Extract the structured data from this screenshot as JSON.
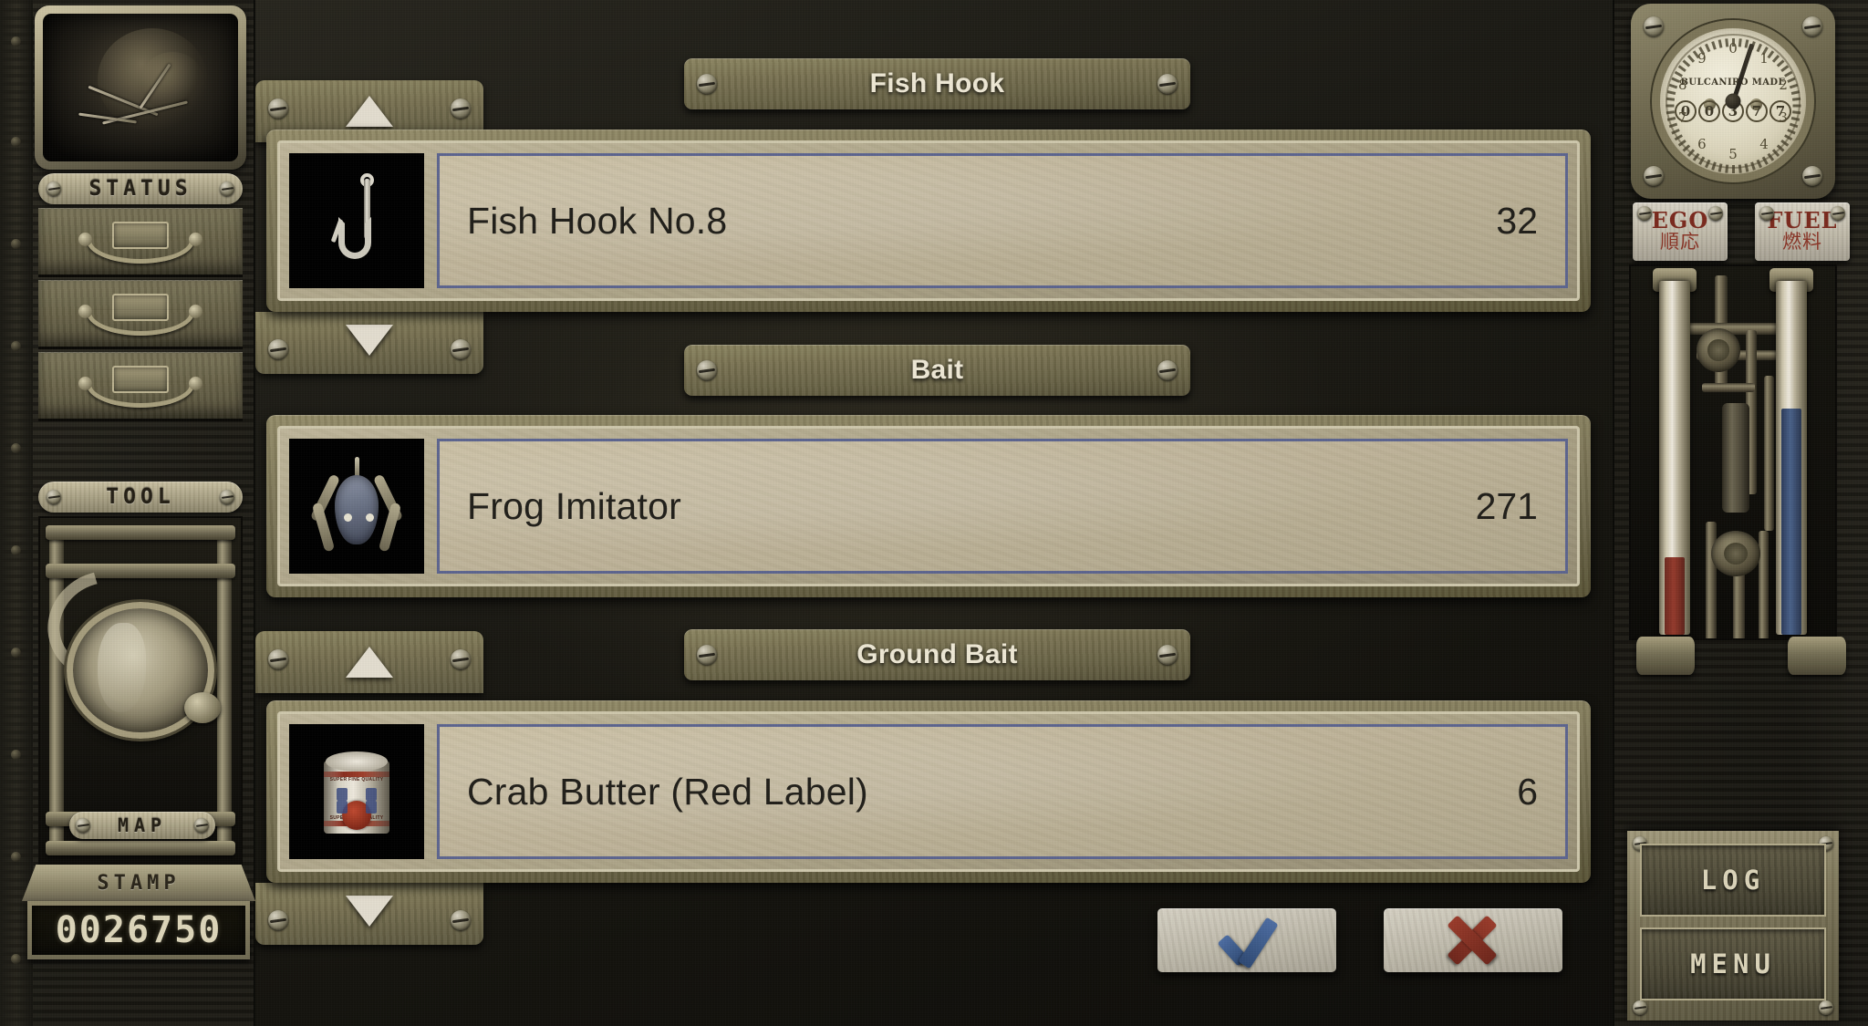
{
  "left_panel": {
    "portrait_alt": "character-portrait",
    "status_label": "STATUS",
    "drawers": [
      {
        "label": "drawer-1"
      },
      {
        "label": "drawer-2"
      },
      {
        "label": "drawer-3"
      }
    ],
    "tool_label": "TOOL",
    "map_label": "MAP",
    "stamp_label": "STAMP",
    "stamp_value": "0026750"
  },
  "right_panel": {
    "gauge": {
      "brand": "BULCANIRO MADE",
      "odometer": [
        "0",
        "0",
        "3",
        "7",
        "7"
      ],
      "dial_numbers": [
        "0",
        "1",
        "2",
        "3",
        "4",
        "5",
        "6",
        "7",
        "8",
        "9"
      ],
      "needle_angle_deg": 198
    },
    "meters": [
      {
        "en": "EGO",
        "jp": "順応",
        "fill_pct": 22,
        "color": "#8a3526"
      },
      {
        "en": "FUEL",
        "jp": "燃料",
        "fill_pct": 64,
        "color": "#44598a"
      }
    ],
    "buttons": [
      {
        "label": "LOG"
      },
      {
        "label": "MENU"
      }
    ]
  },
  "main": {
    "sections": [
      {
        "header": "Fish Hook",
        "has_scroll_arrows": true,
        "icon": "fish-hook-icon",
        "item_name": "Fish Hook No.8",
        "quantity": "32"
      },
      {
        "header": "Bait",
        "has_scroll_arrows": false,
        "icon": "frog-lure-icon",
        "item_name": "Frog Imitator",
        "quantity": "271"
      },
      {
        "header": "Ground Bait",
        "has_scroll_arrows": true,
        "icon": "can-icon",
        "item_name": "Crab Butter (Red Label)",
        "quantity": "6"
      }
    ],
    "actions": {
      "confirm_label": "confirm",
      "cancel_label": "cancel"
    }
  },
  "colors": {
    "selection_border": "#5d6690",
    "parchment": "#c0b59a",
    "brass": "#7e7757",
    "confirm_blue": "#3f5b8c",
    "cancel_red": "#8a3222",
    "text_cream": "#efe9d6",
    "text_dark": "#211f1a"
  }
}
